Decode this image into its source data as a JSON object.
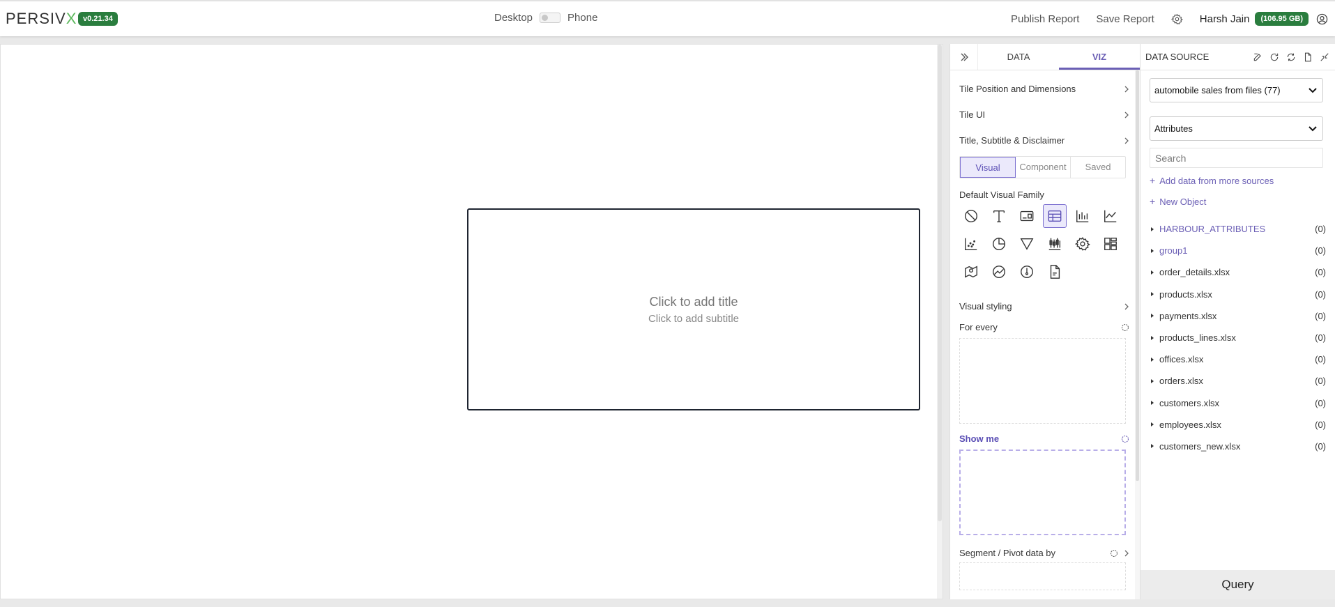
{
  "app": {
    "logo_main": "PERSIV",
    "logo_x": "X",
    "version": "v0.21.34"
  },
  "topbar": {
    "desktop_label": "Desktop",
    "phone_label": "Phone",
    "publish_label": "Publish Report",
    "save_label": "Save Report",
    "user_name": "Harsh Jain",
    "storage": "(106.95 GB)"
  },
  "canvas": {
    "tile_title": "Click to add title",
    "tile_subtitle": "Click to add subtitle"
  },
  "viz_panel": {
    "tabs": [
      {
        "label": "DATA",
        "active": false
      },
      {
        "label": "VIZ",
        "active": true
      }
    ],
    "sections": [
      {
        "label": "Tile Position and Dimensions"
      },
      {
        "label": "Tile UI"
      },
      {
        "label": "Title, Subtitle & Disclaimer"
      }
    ],
    "segments": [
      {
        "label": "Visual",
        "active": true
      },
      {
        "label": "Component",
        "active": false
      },
      {
        "label": "Saved",
        "active": false
      }
    ],
    "family_label": "Default Visual Family",
    "visual_icons": [
      "no-visual-icon",
      "text-icon",
      "card-icon",
      "table-icon",
      "bar-chart-icon",
      "line-chart-icon",
      "scatter-icon",
      "pie-chart-icon",
      "funnel-icon",
      "boxplot-icon",
      "gear-icon",
      "layout-icon",
      "map-icon",
      "globe-chart-icon",
      "gauge-icon",
      "document-icon"
    ],
    "active_icon": "table-icon",
    "visual_styling": "Visual styling",
    "for_every": "For every",
    "show_me": "Show me",
    "segment_pivot": "Segment / Pivot data by",
    "accent": "#6b5fb5"
  },
  "ds_panel": {
    "title": "DATA SOURCE",
    "source_select": "automobile sales from files (77)",
    "attribute_select": "Attributes",
    "search_placeholder": "Search",
    "add_data": "Add data from more sources",
    "new_object": "New Object",
    "tree": [
      {
        "name": "HARBOUR_ATTRIBUTES",
        "count": "(0)",
        "link": true
      },
      {
        "name": "group1",
        "count": "(0)",
        "link": true
      },
      {
        "name": "order_details.xlsx",
        "count": "(0)",
        "link": false
      },
      {
        "name": "products.xlsx",
        "count": "(0)",
        "link": false
      },
      {
        "name": "payments.xlsx",
        "count": "(0)",
        "link": false
      },
      {
        "name": "products_lines.xlsx",
        "count": "(0)",
        "link": false
      },
      {
        "name": "offices.xlsx",
        "count": "(0)",
        "link": false
      },
      {
        "name": "orders.xlsx",
        "count": "(0)",
        "link": false
      },
      {
        "name": "customers.xlsx",
        "count": "(0)",
        "link": false
      },
      {
        "name": "employees.xlsx",
        "count": "(0)",
        "link": false
      },
      {
        "name": "customers_new.xlsx",
        "count": "(0)",
        "link": false
      }
    ],
    "query_label": "Query"
  },
  "colors": {
    "badge_green": "#2a7d3e",
    "accent_purple": "#6b5fb5"
  }
}
